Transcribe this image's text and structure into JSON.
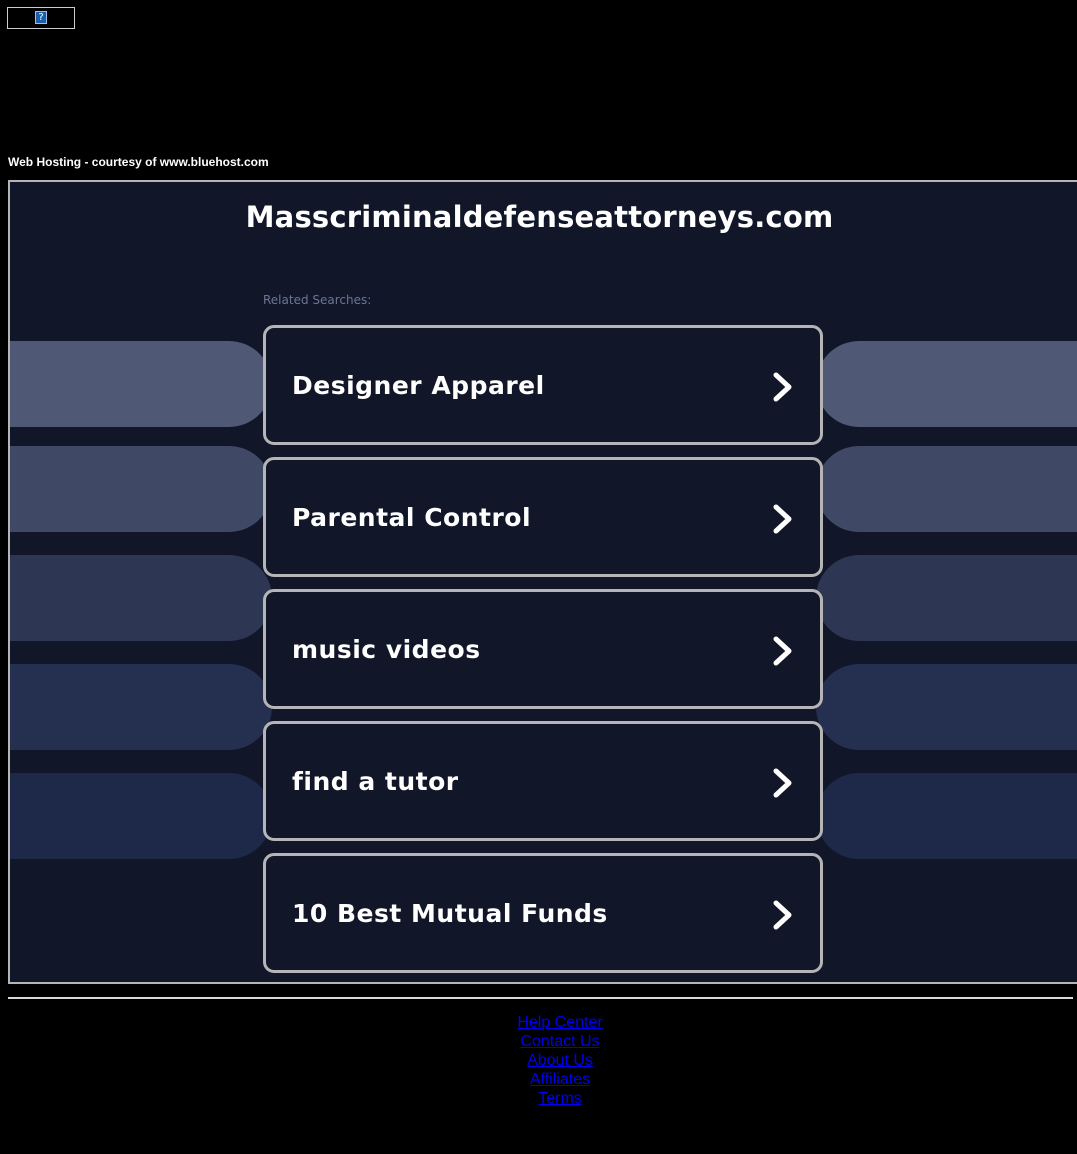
{
  "banner": {
    "placeholder_glyph": "?"
  },
  "hosting_note": "Web Hosting - courtesy of www.bluehost.com",
  "main": {
    "domain_title": "Masscriminaldefenseattorneys.com",
    "related_label": "Related Searches:",
    "searches": [
      {
        "label": "Designer Apparel"
      },
      {
        "label": "Parental Control"
      },
      {
        "label": "music videos"
      },
      {
        "label": "find a tutor"
      },
      {
        "label": "10 Best Mutual Funds"
      }
    ]
  },
  "footer": {
    "links": [
      {
        "label": "Help Center"
      },
      {
        "label": "Contact Us"
      },
      {
        "label": "About Us"
      },
      {
        "label": "Affiliates"
      },
      {
        "label": "Terms"
      }
    ]
  },
  "colors": {
    "page_background": "#000000",
    "panel_background": "#111629",
    "button_border": "#b5b5b5",
    "related_label": "#6b7594",
    "link": "#0000ee",
    "side_pill_shades": [
      "#4f5874",
      "#3f4966",
      "#2d3653",
      "#252f4f",
      "#1e2949"
    ]
  },
  "icons": {
    "banner": "broken-image-icon",
    "search_button": "chevron-right-icon"
  }
}
